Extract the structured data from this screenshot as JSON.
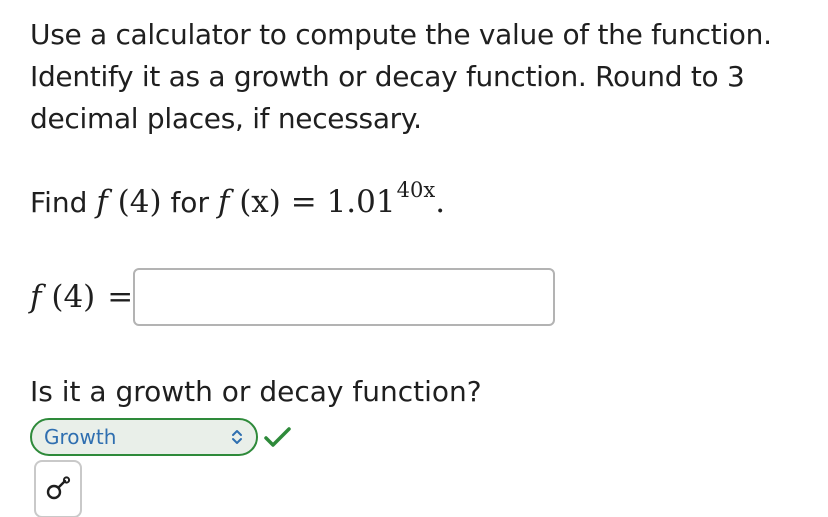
{
  "question": {
    "instructions": "Use a calculator to compute the value of the function. Identify it as a growth or decay function. Round to 3 decimal places, if necessary.",
    "find_word": "Find",
    "find_f_name": "f",
    "find_arg": "(4)",
    "for_word": "for",
    "func_lhs_name": "f",
    "func_lhs_arg": "(x)",
    "equals": "=",
    "base": "1.01",
    "exponent": "40x",
    "period": "."
  },
  "answer": {
    "lhs_name": "f",
    "lhs_arg": "(4)",
    "equals": "=",
    "value": ""
  },
  "growth_question": {
    "prompt": "Is it a growth or decay function?",
    "selected": "Growth",
    "status": "correct"
  },
  "colors": {
    "correct_green": "#2e8a3a",
    "select_text_blue": "#2f6fb0",
    "input_border": "#b3b3b3"
  },
  "icons": {
    "select_arrows": "up-down-chevron-icon",
    "check": "checkmark-icon",
    "tool": "key-symbol-icon"
  }
}
